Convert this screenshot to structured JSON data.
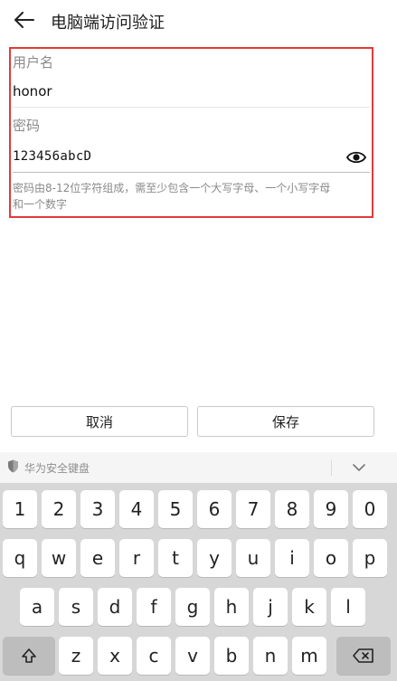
{
  "header": {
    "title": "电脑端访问验证"
  },
  "form": {
    "username_label": "用户名",
    "username_value": "honor",
    "password_label": "密码",
    "password_value": "123456abcD",
    "hint_line1": "密码由8-12位字符组成，需至少包含一个大写字母、一个小写字母",
    "hint_line2": "和一个数字"
  },
  "buttons": {
    "cancel": "取消",
    "save": "保存"
  },
  "keyboard": {
    "brand": "华为安全键盘",
    "rows": [
      [
        "1",
        "2",
        "3",
        "4",
        "5",
        "6",
        "7",
        "8",
        "9",
        "0"
      ],
      [
        "q",
        "w",
        "e",
        "r",
        "t",
        "y",
        "u",
        "i",
        "o",
        "p"
      ],
      [
        "a",
        "s",
        "d",
        "f",
        "g",
        "h",
        "j",
        "k",
        "l"
      ],
      [
        "z",
        "x",
        "c",
        "v",
        "b",
        "n",
        "m"
      ]
    ]
  },
  "colors": {
    "highlight_border": "#e23a3a"
  }
}
